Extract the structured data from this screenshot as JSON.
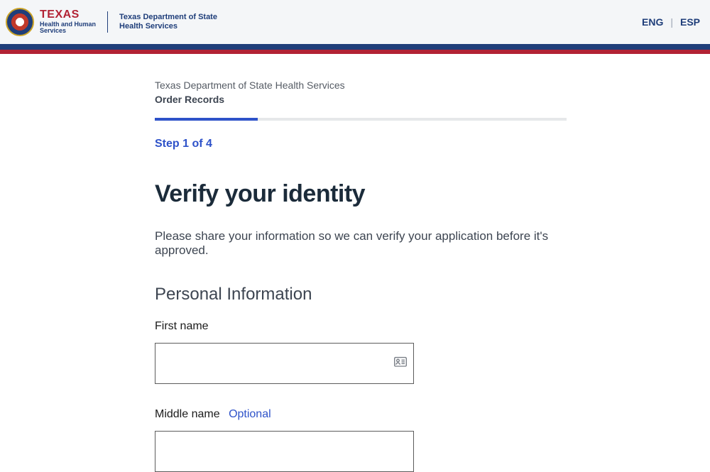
{
  "header": {
    "brand_texas": "TEXAS",
    "brand_sub1": "Health and Human",
    "brand_sub2": "Services",
    "dept_line1": "Texas Department of State",
    "dept_line2": "Health Services",
    "lang_eng": "ENG",
    "lang_esp": "ESP"
  },
  "breadcrumb": {
    "line1": "Texas Department of State Health Services",
    "line2": "Order Records"
  },
  "progress": {
    "step_label": "Step 1 of 4",
    "percent": 25
  },
  "page": {
    "title": "Verify your identity",
    "lead": "Please share your information so we can verify your application before it's approved.",
    "section_heading": "Personal Information"
  },
  "fields": {
    "first_name_label": "First name",
    "first_name_value": "",
    "middle_name_label": "Middle name",
    "middle_optional": "Optional",
    "middle_name_value": ""
  }
}
